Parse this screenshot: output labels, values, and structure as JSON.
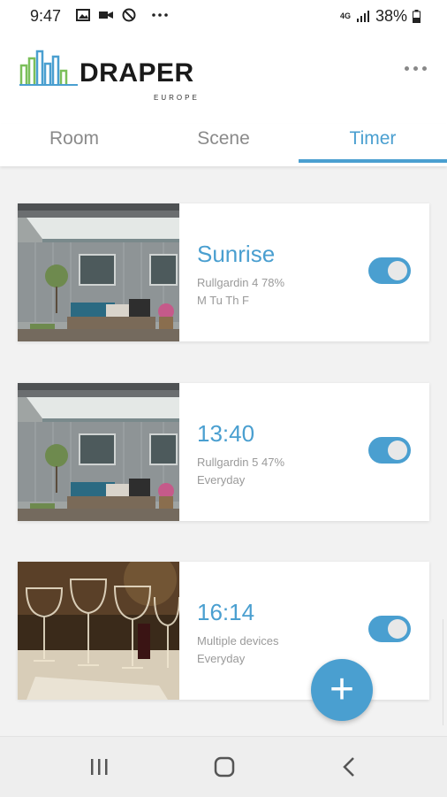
{
  "status_bar": {
    "time": "9:47",
    "network": "4G",
    "battery": "38%",
    "icons": [
      "image-icon",
      "video-icon",
      "blocked-icon",
      "more-notifications-icon",
      "signal-icon",
      "battery-icon"
    ]
  },
  "header": {
    "brand": "DRAPER",
    "brand_sub": "EUROPE",
    "menu_icon": "more-horizontal-icon"
  },
  "tabs": [
    {
      "label": "Room",
      "active": false
    },
    {
      "label": "Scene",
      "active": false
    },
    {
      "label": "Timer",
      "active": true
    }
  ],
  "timers": [
    {
      "title": "Sunrise",
      "device": "Rullgardin 4 78%",
      "days": "M Tu Th F",
      "enabled": true,
      "image": "awning-patio"
    },
    {
      "title": "13:40",
      "device": "Rullgardin 5 47%",
      "days": "Everyday",
      "enabled": true,
      "image": "awning-patio"
    },
    {
      "title": "16:14",
      "device": "Multiple devices",
      "days": "Everyday",
      "enabled": true,
      "image": "wine-glasses"
    }
  ],
  "fab": {
    "label": "+"
  },
  "colors": {
    "accent": "#4a9fd0",
    "background": "#f2f2f2"
  }
}
